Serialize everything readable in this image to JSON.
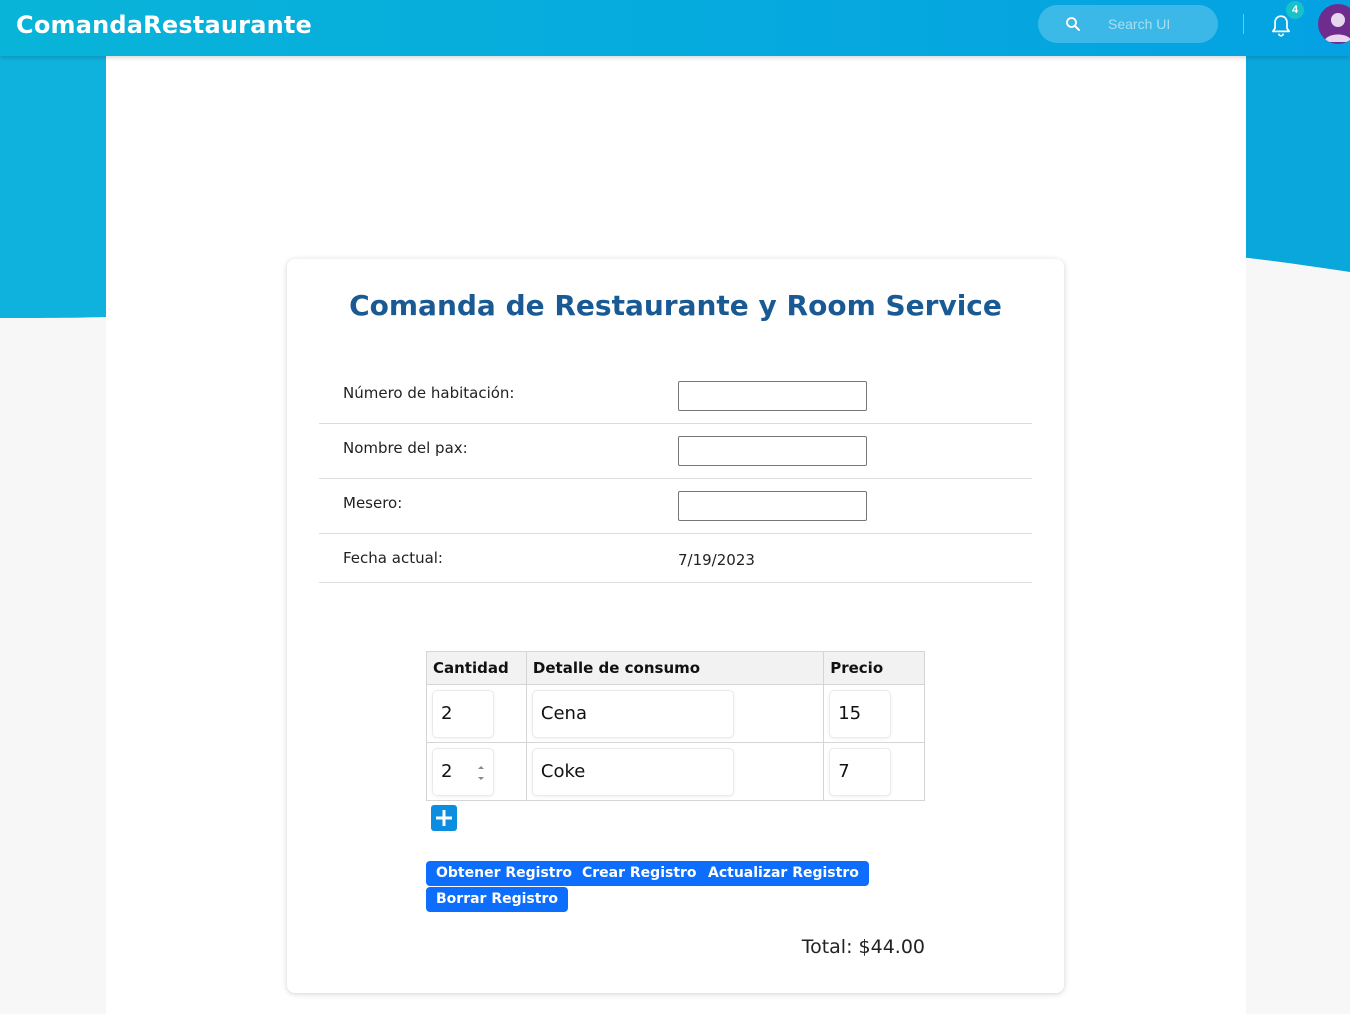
{
  "app": {
    "brand": "ComandaRestaurante",
    "search": {
      "placeholder": "Search UI"
    },
    "notifications_count": "4",
    "colors": {
      "topbar": "#06a9df",
      "accent": "#0d6efd",
      "title": "#1a5a94",
      "avatar": "#6e2c8f",
      "badge": "#17c3c9"
    }
  },
  "card": {
    "title": "Comanda de Restaurante y Room Service",
    "fields": [
      {
        "label": "Número de habitación:",
        "value": ""
      },
      {
        "label": "Nombre del pax:",
        "value": ""
      },
      {
        "label": "Mesero:",
        "value": ""
      },
      {
        "label": "Fecha actual:",
        "value": "7/19/2023"
      }
    ],
    "table": {
      "headers": [
        "Cantidad",
        "Detalle de consumo",
        "Precio"
      ],
      "rows": [
        {
          "cantidad": "2",
          "detalle": "Cena",
          "precio": "15"
        },
        {
          "cantidad": "2",
          "detalle": "Coke",
          "precio": "7"
        }
      ]
    },
    "buttons": {
      "obtener": "Obtener Registro",
      "crear": "Crear Registro",
      "actualizar": "Actualizar Registro",
      "borrar": "Borrar Registro"
    },
    "total": "Total: $44.00"
  }
}
